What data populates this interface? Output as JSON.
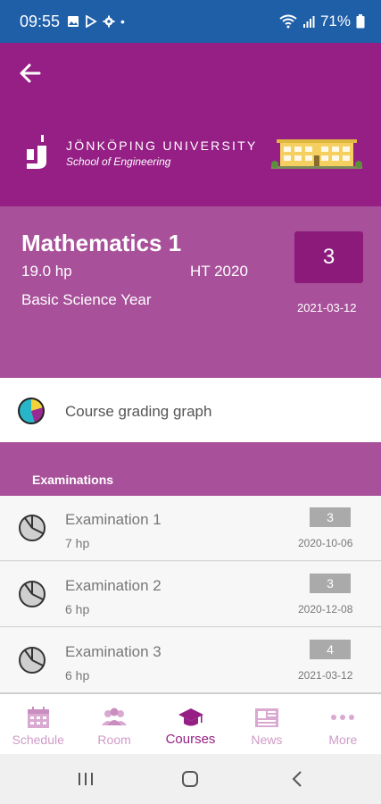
{
  "status_bar": {
    "time": "09:55",
    "battery": "71%",
    "dot": "•",
    "bg_color": "#1f5fa8"
  },
  "header": {
    "university": "JÖNKÖPING UNIVERSITY",
    "school": "School of Engineering",
    "brand_color": "#951f85"
  },
  "course": {
    "title": "Mathematics 1",
    "credits": "19.0 hp",
    "term": "HT 2020",
    "program": "Basic Science Year",
    "grade": "3",
    "date": "2021-03-12"
  },
  "grading_graph": {
    "label": "Course grading graph"
  },
  "examinations": {
    "title": "Examinations",
    "items": [
      {
        "name": "Examination 1",
        "credits": "7 hp",
        "grade": "3",
        "date": "2020-10-06"
      },
      {
        "name": "Examination 2",
        "credits": "6 hp",
        "grade": "3",
        "date": "2020-12-08"
      },
      {
        "name": "Examination 3",
        "credits": "6 hp",
        "grade": "4",
        "date": "2021-03-12"
      }
    ]
  },
  "bottom_nav": {
    "items": [
      {
        "label": "Schedule",
        "icon": "calendar-icon"
      },
      {
        "label": "Room",
        "icon": "people-icon"
      },
      {
        "label": "Courses",
        "icon": "graduation-cap-icon",
        "active": true
      },
      {
        "label": "News",
        "icon": "newspaper-icon"
      },
      {
        "label": "More",
        "icon": "more-dots-icon"
      }
    ]
  }
}
